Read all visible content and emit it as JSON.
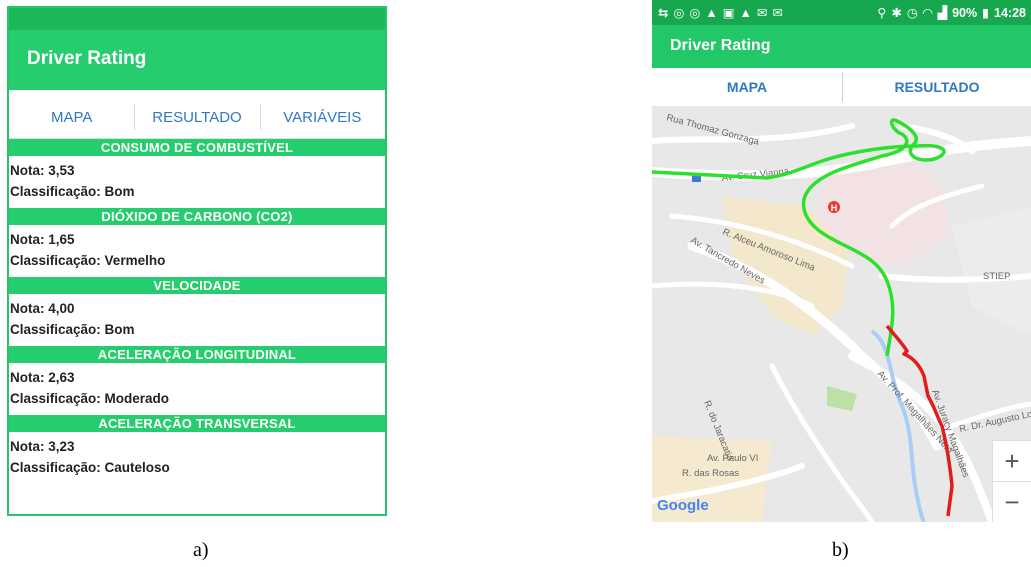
{
  "screenshot_a": {
    "app_title": "Driver Rating",
    "tabs": [
      "MAPA",
      "RESULTADO",
      "VARIÁVEIS"
    ],
    "sections": [
      {
        "title": "CONSUMO DE COMBUSTÍVEL",
        "nota": "Nota: 3,53",
        "classificacao": "Classificação: Bom"
      },
      {
        "title": "DIÓXIDO DE CARBONO (CO2)",
        "nota": "Nota: 1,65",
        "classificacao": "Classificação: Vermelho"
      },
      {
        "title": "VELOCIDADE",
        "nota": "Nota: 4,00",
        "classificacao": "Classificação: Bom"
      },
      {
        "title": "ACELERAÇÃO LONGITUDINAL",
        "nota": "Nota: 2,63",
        "classificacao": "Classificação: Moderado"
      },
      {
        "title": "ACELERAÇÃO TRANSVERSAL",
        "nota": "Nota: 3,23",
        "classificacao": "Classificação: Cauteloso"
      }
    ]
  },
  "screenshot_b": {
    "status": {
      "battery": "90%",
      "time": "14:28"
    },
    "app_title": "Driver Rating",
    "tabs": [
      "MAPA",
      "RESULTADO"
    ],
    "map": {
      "streets": {
        "rua_thomaz": "Rua Thomaz Gonzaga",
        "av_cruz_vianna": "Av. Cruz Vianna",
        "r_alceu": "R. Alceu Amoroso Lima",
        "av_tancredo": "Av. Tancredo Neves",
        "stiep": "STIEP",
        "av_prof": "Av. Prof. Magalhães Neto",
        "r_jaracatia": "R. do Jaracatiá",
        "r_dr_augusto": "R. Dr. Augusto Lo",
        "av_paulo": "Av. Paulo VI",
        "r_rosas": "R. das Rosas",
        "av_juracy": "Av. Juracy Magalhães"
      },
      "zoom_in": "+",
      "zoom_out": "−",
      "google": "Google"
    }
  },
  "captions": {
    "a": "a)",
    "b": "b)"
  },
  "colors": {
    "green_bar": "#26cd6e",
    "route_green": "#22e022",
    "route_red": "#e41b1b",
    "tab_blue": "#2f78c4"
  }
}
